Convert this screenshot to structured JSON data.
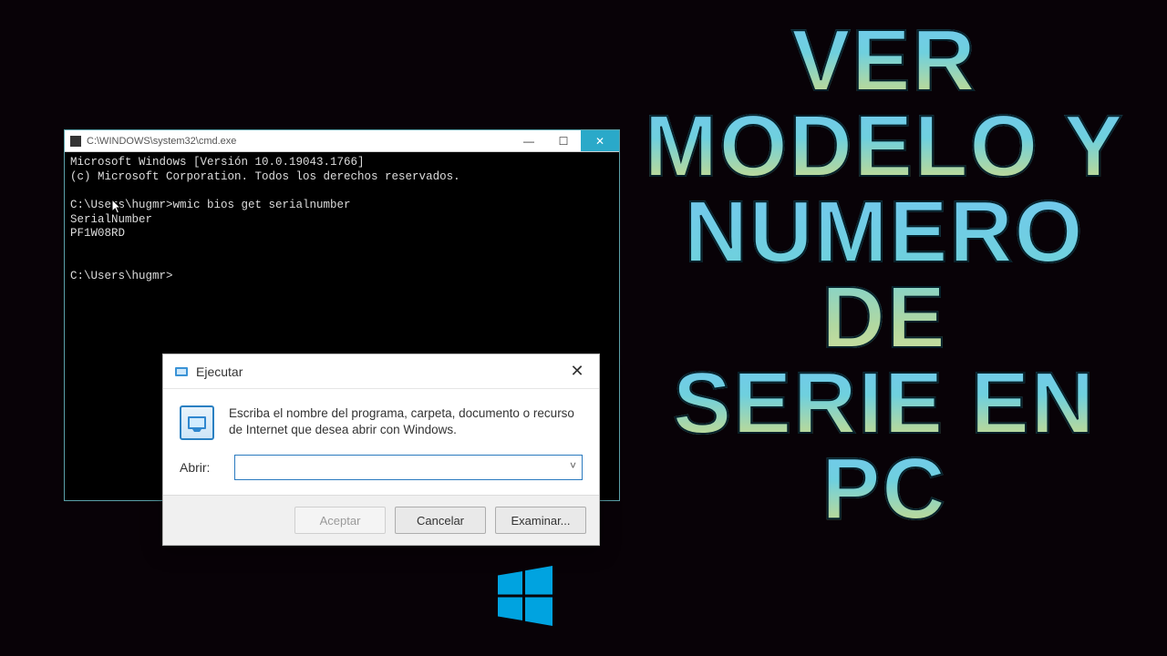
{
  "headline": {
    "line1": "Ver",
    "line2": "modelo y",
    "line3": "numero de",
    "line4": "serie en",
    "line5": "PC"
  },
  "cmd": {
    "title": "C:\\WINDOWS\\system32\\cmd.exe",
    "controls": {
      "min": "—",
      "max": "☐",
      "close": "✕"
    },
    "lines": {
      "l1": "Microsoft Windows [Versión 10.0.19043.1766]",
      "l2": "(c) Microsoft Corporation. Todos los derechos reservados.",
      "l3": "",
      "l4": "C:\\Users\\hugmr>wmic bios get serialnumber",
      "l5": "SerialNumber",
      "l6": "PF1W08RD",
      "l7": "",
      "l8": "",
      "l9": "C:\\Users\\hugmr>"
    }
  },
  "run": {
    "title": "Ejecutar",
    "close": "✕",
    "description": "Escriba el nombre del programa, carpeta, documento o recurso de Internet que desea abrir con Windows.",
    "open_label": "Abrir:",
    "input_value": "",
    "buttons": {
      "ok": "Aceptar",
      "cancel": "Cancelar",
      "browse": "Examinar..."
    }
  }
}
